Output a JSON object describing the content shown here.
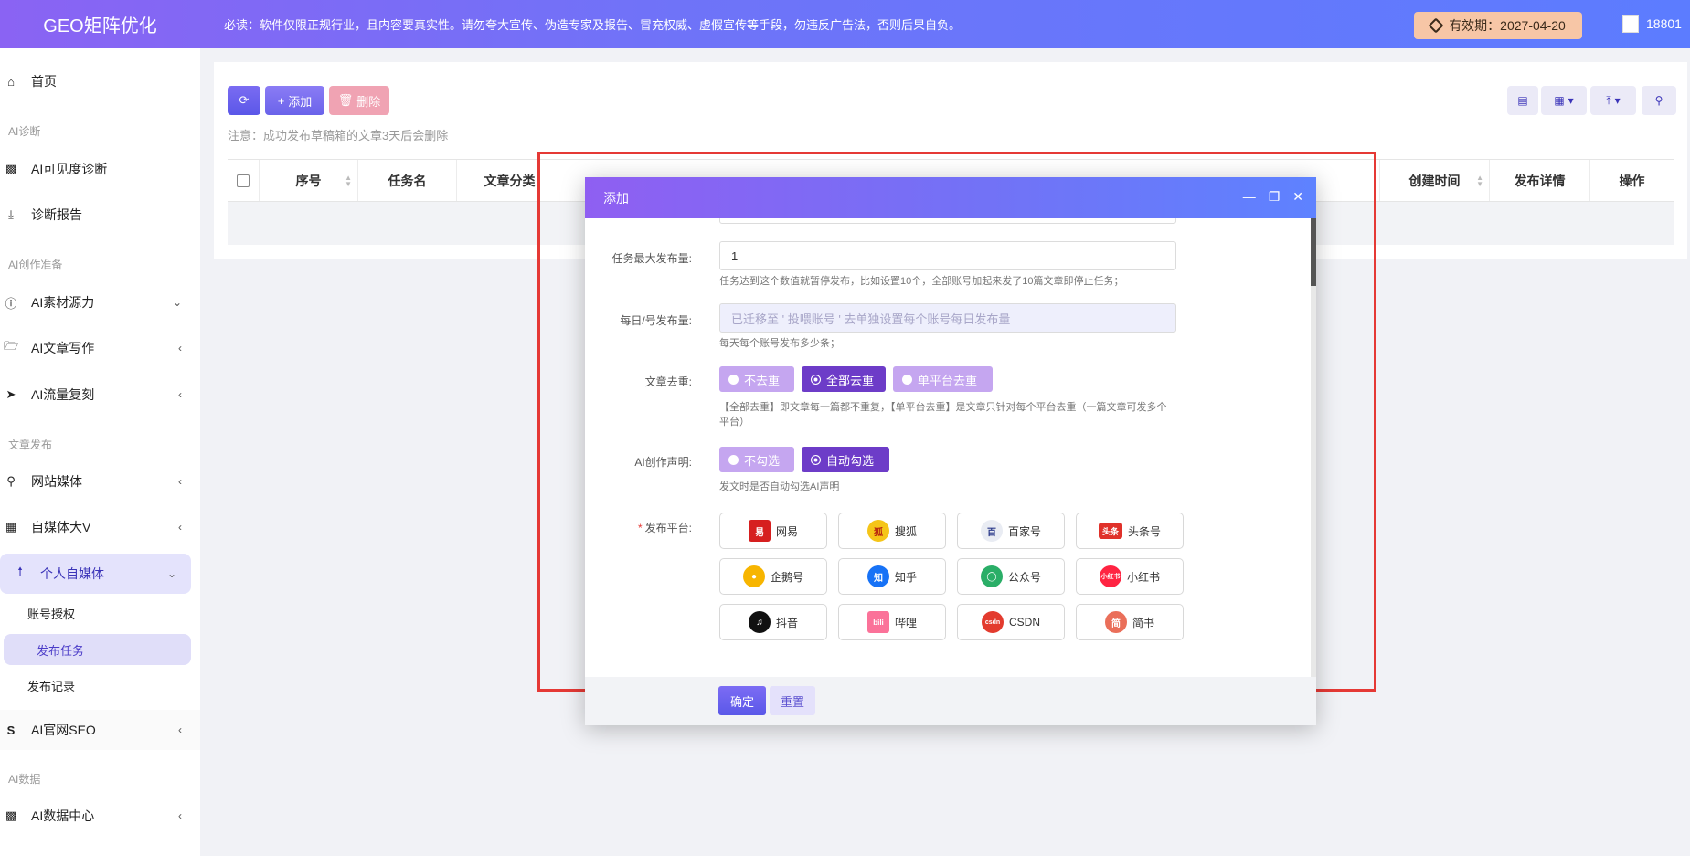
{
  "header": {
    "brand": "GEO矩阵优化",
    "notice": "必读：软件仅限正规行业，且内容要真实性。请勿夸大宣传、伪造专家及报告、冒充权威、虚假宣传等手段，勿违反广告法，否则后果自负。",
    "expiry": "有效期：2027-04-20",
    "user": "18801"
  },
  "sidebar": {
    "home": "首页",
    "sec_diag": "AI诊断",
    "visibility": "AI可见度诊断",
    "report": "诊断报告",
    "sec_prep": "AI创作准备",
    "material": "AI素材源力",
    "writing": "AI文章写作",
    "traffic": "AI流量复刻",
    "sec_publish": "文章发布",
    "website": "网站媒体",
    "bigv": "自媒体大V",
    "personal": "个人自媒体",
    "account_auth": "账号授权",
    "publish_task": "发布任务",
    "publish_log": "发布记录",
    "seo": "AI官网SEO",
    "sec_data": "AI数据",
    "data_center": "AI数据中心"
  },
  "toolbar": {
    "add": "添加",
    "delete": "删除",
    "tip": "注意：成功发布草稿箱的文章3天后会删除"
  },
  "table": {
    "columns": [
      "序号",
      "任务名",
      "文章分类",
      "创建时间",
      "发布详情",
      "操作"
    ]
  },
  "modal": {
    "title": "添加",
    "max_label": "任务最大发布量:",
    "max_value": "1",
    "max_help": "任务达到这个数值就暂停发布，比如设置10个，全部账号加起来发了10篇文章即停止任务；",
    "daily_label": "每日/号发布量:",
    "daily_placeholder": "已迁移至 ' 投喂账号 ' 去单独设置每个账号每日发布量",
    "daily_help": "每天每个账号发布多少条；",
    "dedupe_label": "文章去重:",
    "dedupe_options": [
      "不去重",
      "全部去重",
      "单平台去重"
    ],
    "dedupe_help": "【全部去重】即文章每一篇都不重复，【单平台去重】是文章只针对每个平台去重（一篇文章可发多个平台）",
    "ai_label": "AI创作声明:",
    "ai_options": [
      "不勾选",
      "自动勾选"
    ],
    "ai_help": "发文时是否自动勾选AI声明",
    "platform_label": "发布平台:",
    "platforms": [
      "网易",
      "搜狐",
      "百家号",
      "头条号",
      "企鹅号",
      "知乎",
      "公众号",
      "小红书",
      "抖音",
      "哔哩",
      "CSDN",
      "简书"
    ],
    "confirm": "确定",
    "reset": "重置"
  },
  "colors": {
    "accent": "#6a63ea",
    "header_start": "#8a63f3",
    "header_end": "#5c7cff",
    "annotation": "#e53935"
  }
}
